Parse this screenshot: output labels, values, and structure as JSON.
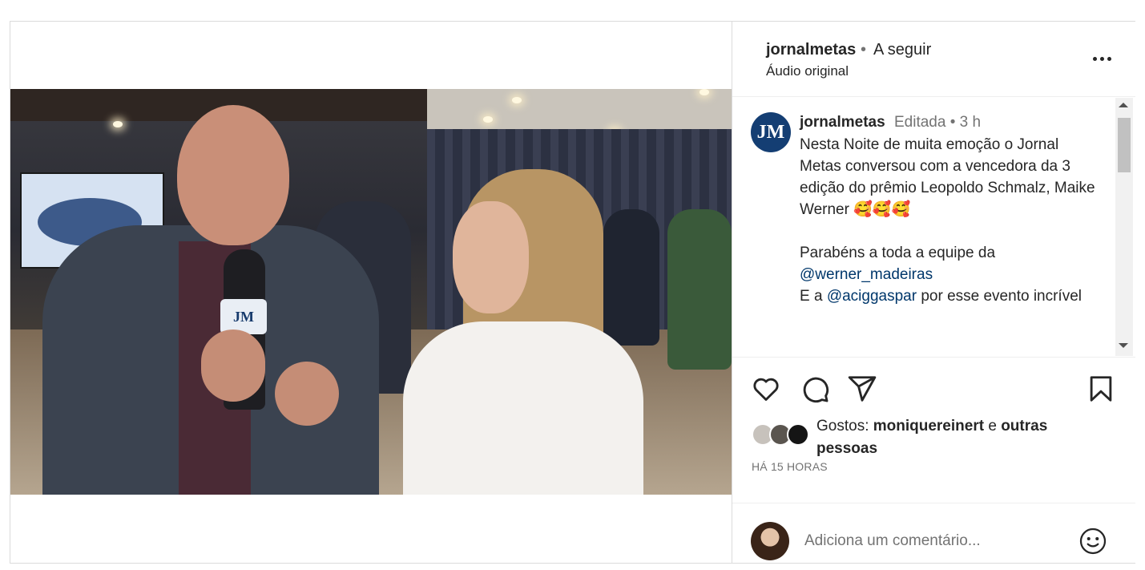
{
  "post": {
    "header": {
      "username": "jornalmetas",
      "separator": "•",
      "follow_label": "A seguir",
      "audio": "Áudio original"
    },
    "caption": {
      "avatar_text": "JM",
      "username": "jornalmetas",
      "meta": "Editada •  3 h",
      "line1": "Nesta Noite de muita emoção o Jornal Metas conversou com a vencedora da 3 edição do prêmio Leopoldo Schmalz, Maike Werner 🥰🥰🥰",
      "line2_prefix": "Parabéns a toda a equipe da",
      "mention1": "@werner_madeiras",
      "line3_prefix": "E a",
      "mention2": "@aciggaspar",
      "line3_suffix": " por esse evento incrível"
    },
    "video": {
      "mic_logo": "JM"
    },
    "likes": {
      "prefix": "Gostos: ",
      "user": "moniquereinert",
      "middle": " e ",
      "rest": "outras pessoas"
    },
    "timestamp": "HÁ 15 HORAS",
    "comment": {
      "placeholder": "Adiciona um comentário..."
    }
  },
  "icons": [
    "mute-icon",
    "more-icon",
    "heart-icon",
    "comment-icon",
    "share-icon",
    "bookmark-icon",
    "emoji-icon"
  ]
}
